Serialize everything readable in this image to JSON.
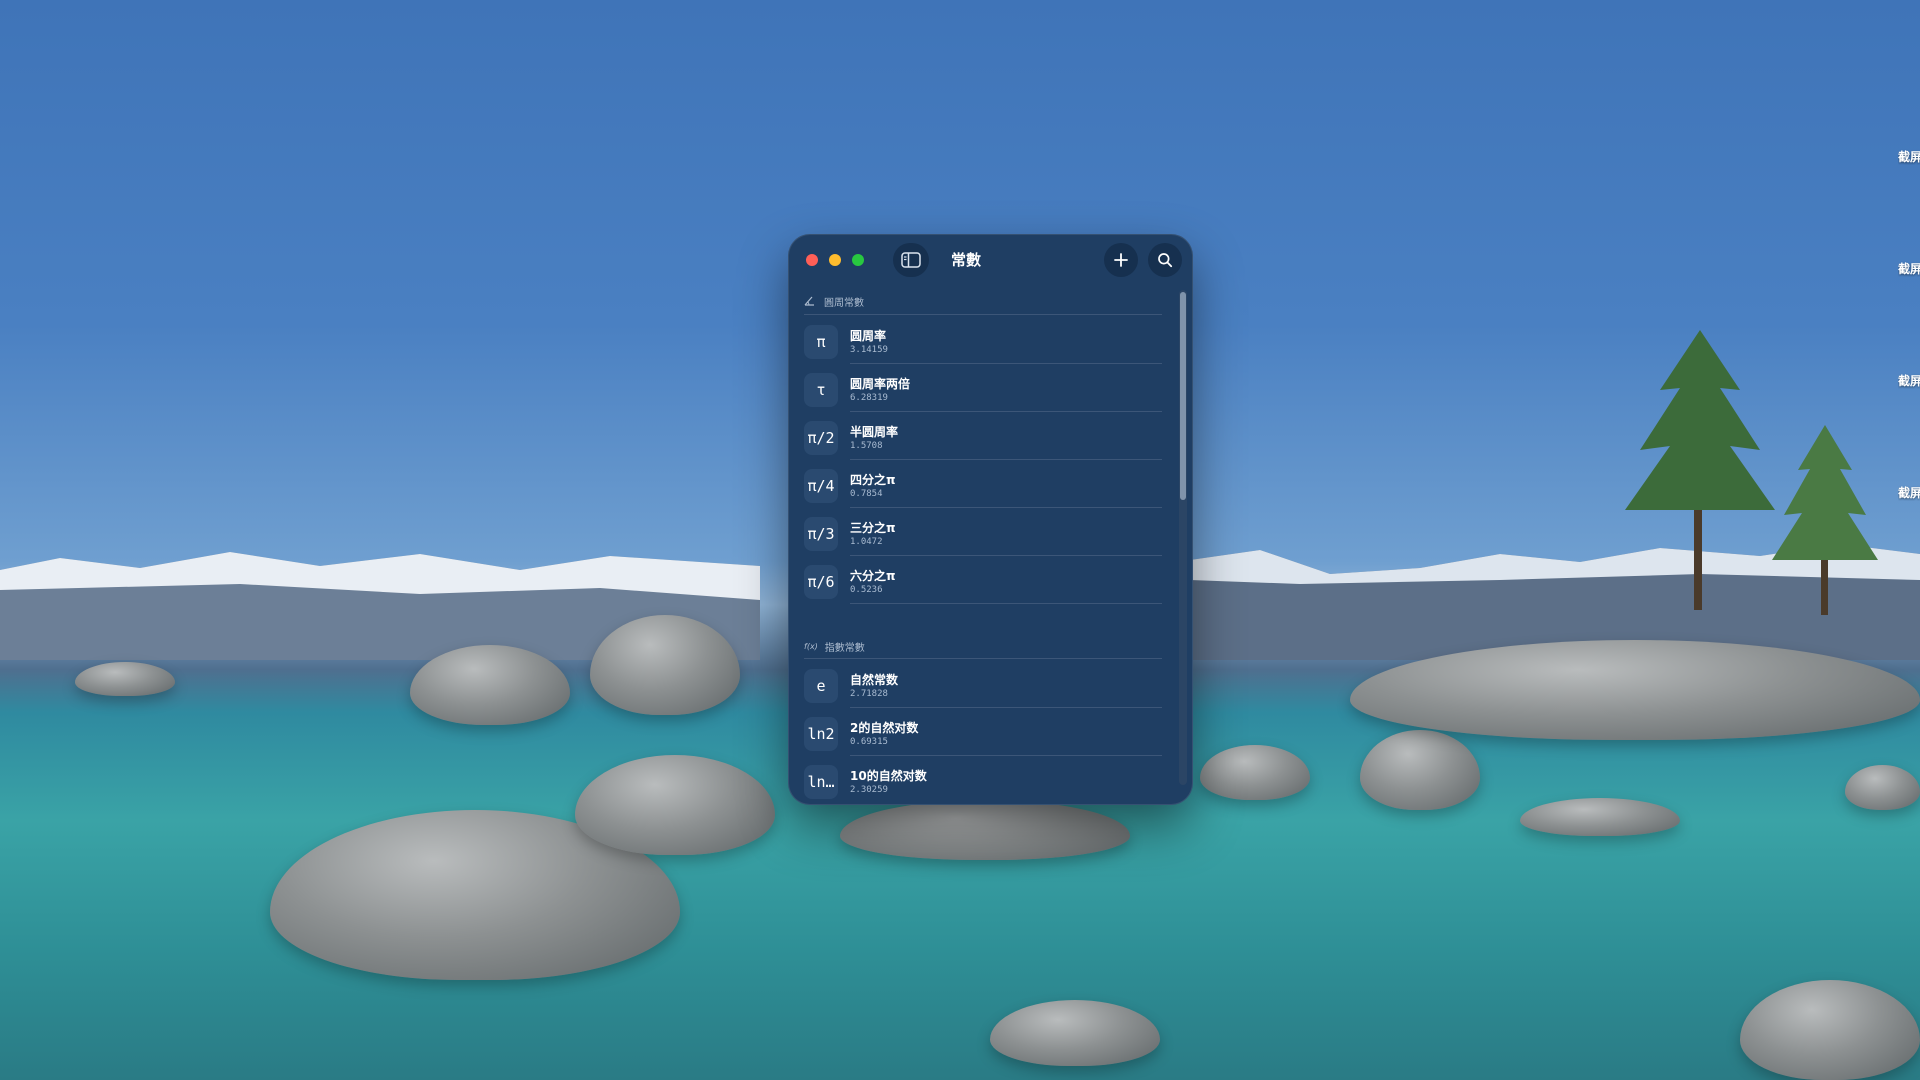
{
  "window": {
    "title": "常數"
  },
  "sections": [
    {
      "header": "圓周常數",
      "icon": "angle-icon",
      "items": [
        {
          "symbol": "π",
          "name": "圆周率",
          "value": "3.14159"
        },
        {
          "symbol": "τ",
          "name": "圆周率两倍",
          "value": "6.28319"
        },
        {
          "symbol": "π/2",
          "name": "半圆周率",
          "value": "1.5708"
        },
        {
          "symbol": "π/4",
          "name": "四分之π",
          "value": "0.7854"
        },
        {
          "symbol": "π/3",
          "name": "三分之π",
          "value": "1.0472"
        },
        {
          "symbol": "π/6",
          "name": "六分之π",
          "value": "0.5236"
        }
      ]
    },
    {
      "header": "指數常數",
      "icon_text": "f(x)",
      "items": [
        {
          "symbol": "e",
          "name": "自然常数",
          "value": "2.71828"
        },
        {
          "symbol": "ln2",
          "name": "2的自然对数",
          "value": "0.69315"
        },
        {
          "symbol": "ln…",
          "name": "10的自然对数",
          "value": "2.30259"
        }
      ]
    }
  ],
  "desktop": {
    "labels": [
      "截屏",
      "截屏",
      "截屏",
      "截屏"
    ]
  },
  "colors": {
    "window_bg": "#1f3e63",
    "row_symbol_bg": "#2a4a70",
    "close": "#ff5f57",
    "minimize": "#febc2e",
    "zoom": "#28c840"
  }
}
